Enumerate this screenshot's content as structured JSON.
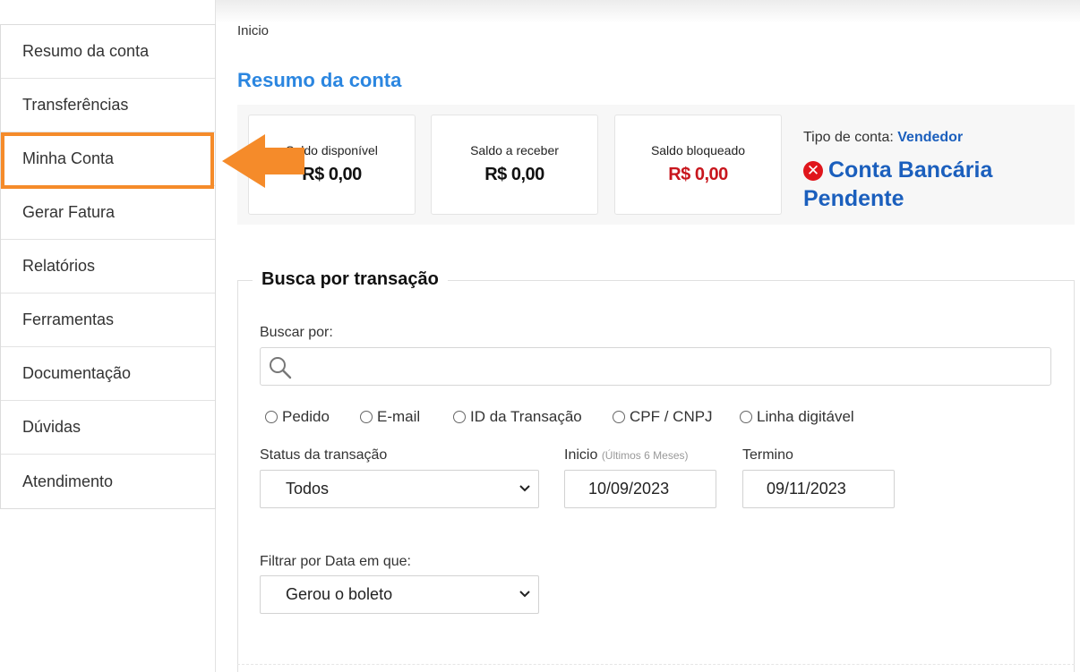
{
  "sidebar": {
    "items": [
      {
        "label": "Resumo da conta"
      },
      {
        "label": "Transferências"
      },
      {
        "label": "Minha Conta"
      },
      {
        "label": "Gerar Fatura"
      },
      {
        "label": "Relatórios"
      },
      {
        "label": "Ferramentas"
      },
      {
        "label": "Documentação"
      },
      {
        "label": "Dúvidas"
      },
      {
        "label": "Atendimento"
      }
    ],
    "highlighted": "Minha Conta"
  },
  "breadcrumb": "Inicio",
  "page_title": "Resumo da conta",
  "summary": {
    "cards": [
      {
        "label": "Saldo disponível",
        "value": "R$ 0,00"
      },
      {
        "label": "Saldo a receber",
        "value": "R$ 0,00"
      },
      {
        "label": "Saldo bloqueado",
        "value": "R$ 0,00"
      }
    ],
    "account_type_label": "Tipo de conta:",
    "account_type_value": "Vendedor",
    "pending_status": "Conta Bancária Pendente",
    "pending_icon": "x-circle-icon"
  },
  "search": {
    "title": "Busca por transação",
    "search_by_label": "Buscar por:",
    "search_value": "",
    "radios": [
      "Pedido",
      "E-mail",
      "ID da Transação",
      "CPF / CNPJ",
      "Linha digitável"
    ],
    "status_label": "Status da transação",
    "status_value": "Todos",
    "start_label": "Inicio",
    "start_hint": "(Últimos 6 Meses)",
    "start_value": "10/09/2023",
    "end_label": "Termino",
    "end_value": "09/11/2023",
    "filter_label": "Filtrar por Data em que:",
    "filter_value": "Gerou o boleto"
  },
  "colors": {
    "accent": "#2b86e0",
    "link_blue": "#1b5fbd",
    "annotation_orange": "#f58b2a",
    "blocked_red": "#c8161d",
    "error_red": "#e0161c"
  }
}
